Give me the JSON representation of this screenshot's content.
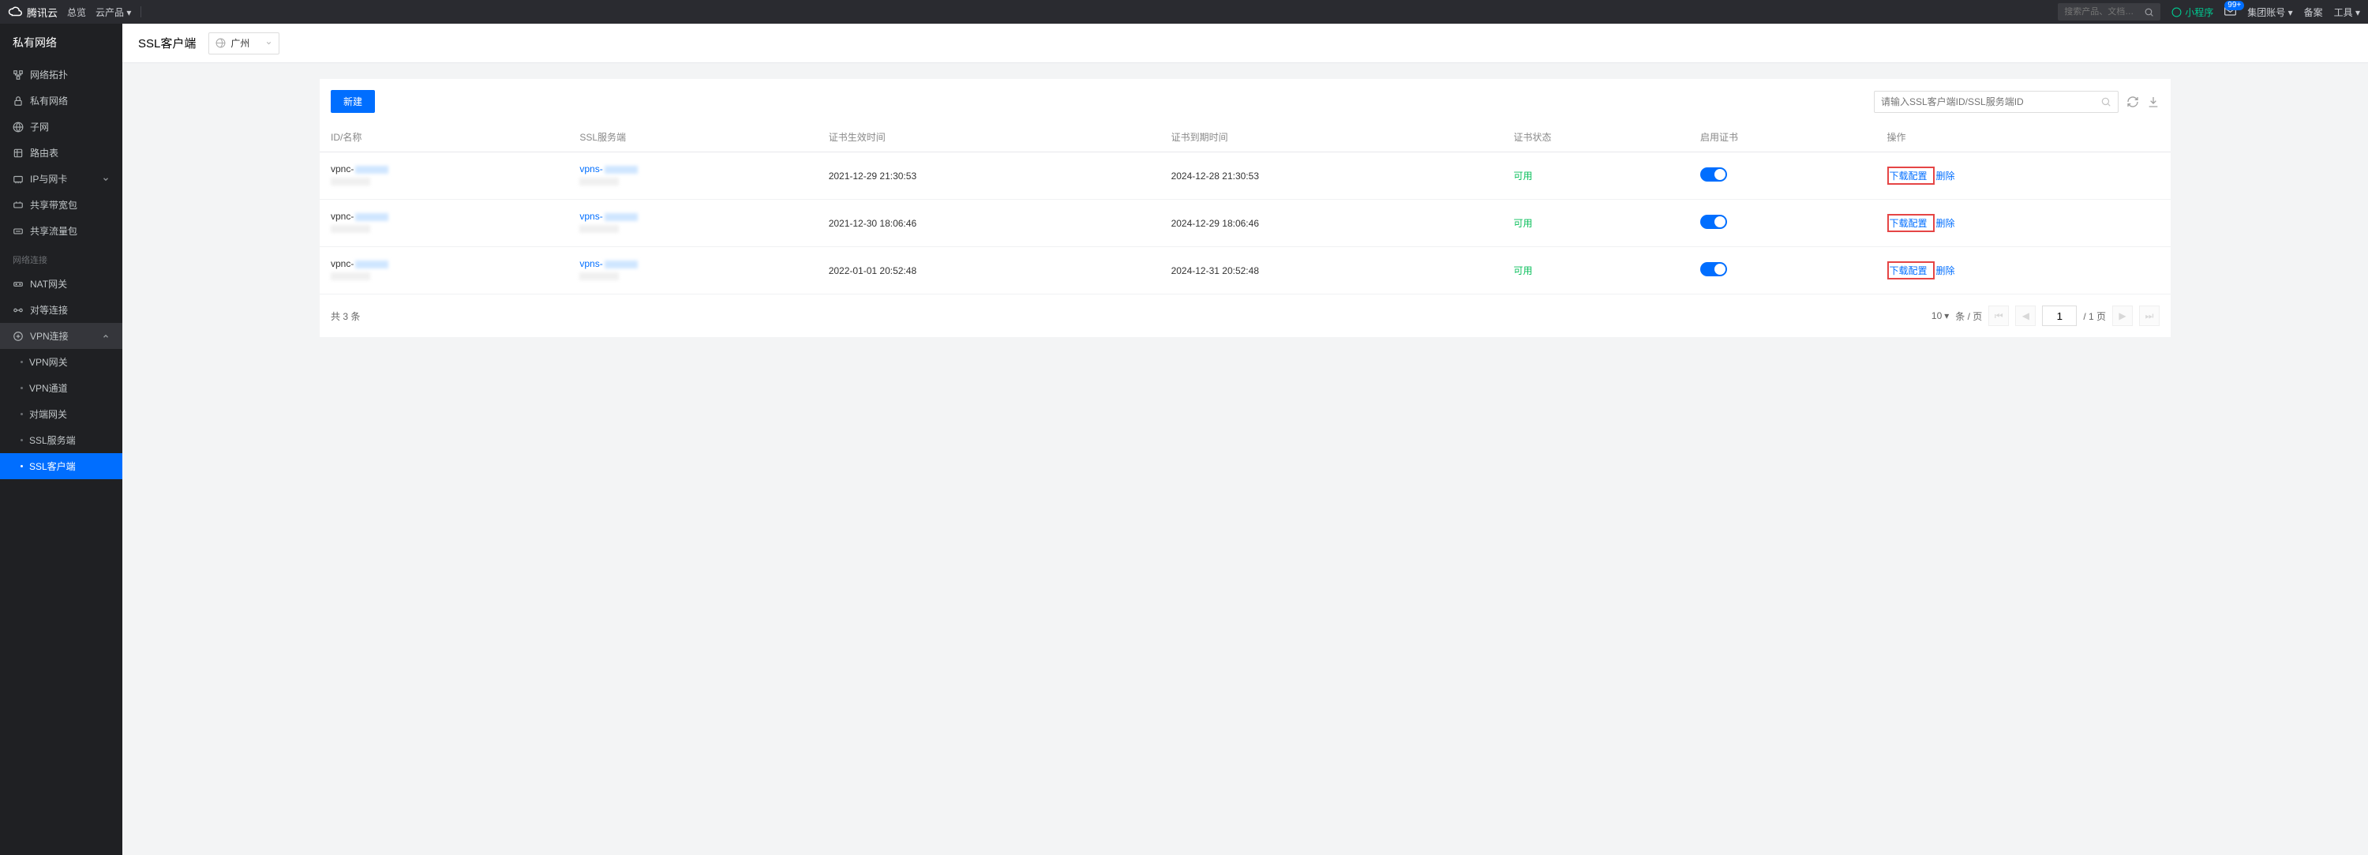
{
  "top": {
    "brand": "腾讯云",
    "overview": "总览",
    "cloud_products": "云产品",
    "search_placeholder": "搜索产品、文档…",
    "miniprogram": "小程序",
    "badge": "99+",
    "account": "集团账号",
    "beian": "备案",
    "tools": "工具"
  },
  "sidebar": {
    "title": "私有网络",
    "items": [
      {
        "label": "网络拓扑",
        "icon": "topology"
      },
      {
        "label": "私有网络",
        "icon": "lock"
      },
      {
        "label": "子网",
        "icon": "globe"
      },
      {
        "label": "路由表",
        "icon": "route"
      },
      {
        "label": "IP与网卡",
        "icon": "nic",
        "expandable": true
      },
      {
        "label": "共享带宽包",
        "icon": "bandwidth"
      },
      {
        "label": "共享流量包",
        "icon": "traffic"
      }
    ],
    "group_label": "网络连接",
    "group_items": [
      {
        "label": "NAT网关",
        "icon": "nat"
      },
      {
        "label": "对等连接",
        "icon": "peer"
      },
      {
        "label": "VPN连接",
        "icon": "vpn",
        "expanded": true,
        "subs": [
          {
            "label": "VPN网关"
          },
          {
            "label": "VPN通道"
          },
          {
            "label": "对端网关"
          },
          {
            "label": "SSL服务端"
          },
          {
            "label": "SSL客户端",
            "active": true
          }
        ]
      }
    ]
  },
  "page": {
    "title": "SSL客户端",
    "region": "广州"
  },
  "toolbar": {
    "new_label": "新建",
    "search_placeholder": "请输入SSL客户端ID/SSL服务端ID"
  },
  "table": {
    "columns": [
      "ID/名称",
      "SSL服务端",
      "证书生效时间",
      "证书到期时间",
      "证书状态",
      "启用证书",
      "操作"
    ],
    "rows": [
      {
        "id": "vpnc-",
        "svc": "vpns-",
        "start": "2021-12-29 21:30:53",
        "end": "2024-12-28 21:30:53",
        "status": "可用",
        "enabled": true
      },
      {
        "id": "vpnc-",
        "svc": "vpns-",
        "start": "2021-12-30 18:06:46",
        "end": "2024-12-29 18:06:46",
        "status": "可用",
        "enabled": true
      },
      {
        "id": "vpnc-",
        "svc": "vpns-",
        "start": "2022-01-01 20:52:48",
        "end": "2024-12-31 20:52:48",
        "status": "可用",
        "enabled": true
      }
    ],
    "ops": {
      "download": "下载配置",
      "delete": "删除"
    }
  },
  "pagination": {
    "total_prefix": "共",
    "total_count": "3",
    "total_suffix": "条",
    "page_size": "10",
    "per_page_label": "条 / 页",
    "current": "1",
    "total_pages": "/ 1 页"
  }
}
